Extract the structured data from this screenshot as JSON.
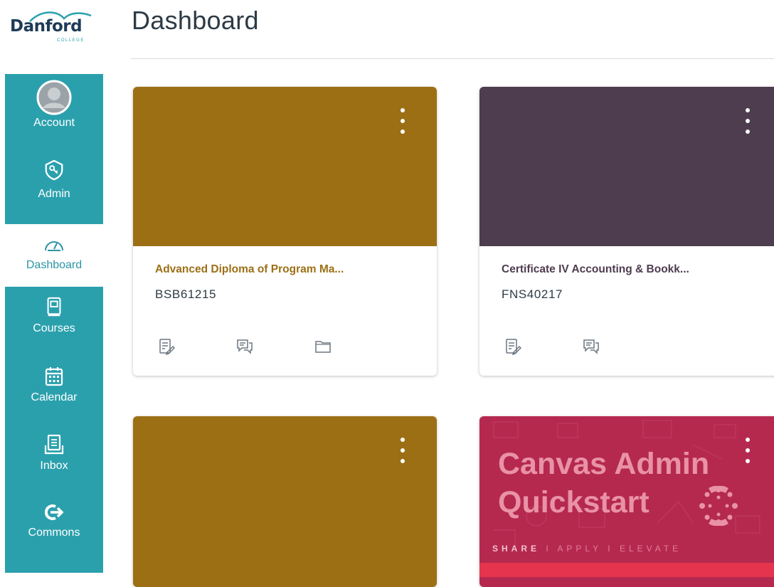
{
  "brand": {
    "name": "Danford",
    "sub": "COLLEGE"
  },
  "page": {
    "title": "Dashboard"
  },
  "nav": [
    {
      "id": "account",
      "label": "Account",
      "icon": "avatar-icon",
      "highlighted": true
    },
    {
      "id": "admin",
      "label": "Admin",
      "icon": "shield-key-icon",
      "highlighted": true
    },
    {
      "id": "dashboard",
      "label": "Dashboard",
      "icon": "speedometer-icon",
      "highlighted": false
    },
    {
      "id": "courses",
      "label": "Courses",
      "icon": "book-icon",
      "highlighted": true
    },
    {
      "id": "calendar",
      "label": "Calendar",
      "icon": "calendar-icon",
      "highlighted": true
    },
    {
      "id": "inbox",
      "label": "Inbox",
      "icon": "inbox-icon",
      "highlighted": true
    },
    {
      "id": "commons",
      "label": "Commons",
      "icon": "share-arrow-icon",
      "highlighted": true
    }
  ],
  "cards": [
    {
      "name": "Advanced Diploma of Program Ma...",
      "code": "BSB61215",
      "color": "#9c6f15",
      "name_color": "#9c6f15",
      "actions": [
        "assignments-icon",
        "discussions-icon",
        "files-icon"
      ]
    },
    {
      "name": "Certificate IV Accounting & Bookk...",
      "code": "FNS40217",
      "color": "#4e3c4f",
      "name_color": "#4e3c4f",
      "actions": [
        "assignments-icon",
        "discussions-icon"
      ]
    },
    {
      "name": "",
      "code": "",
      "color": "#9c6f15",
      "name_color": "#9c6f15",
      "actions": []
    },
    {
      "name": "",
      "code": "",
      "color": "#b5294f",
      "name_color": "#b5294f",
      "actions": [],
      "hero_line1": "Canvas Admin",
      "hero_line2": "Quickstart",
      "tag_share": "SHARE",
      "tag_rest": " I APPLY I ELEVATE"
    }
  ],
  "colors": {
    "nav_bg": "#2ba0ad",
    "title": "#2d3b45"
  }
}
